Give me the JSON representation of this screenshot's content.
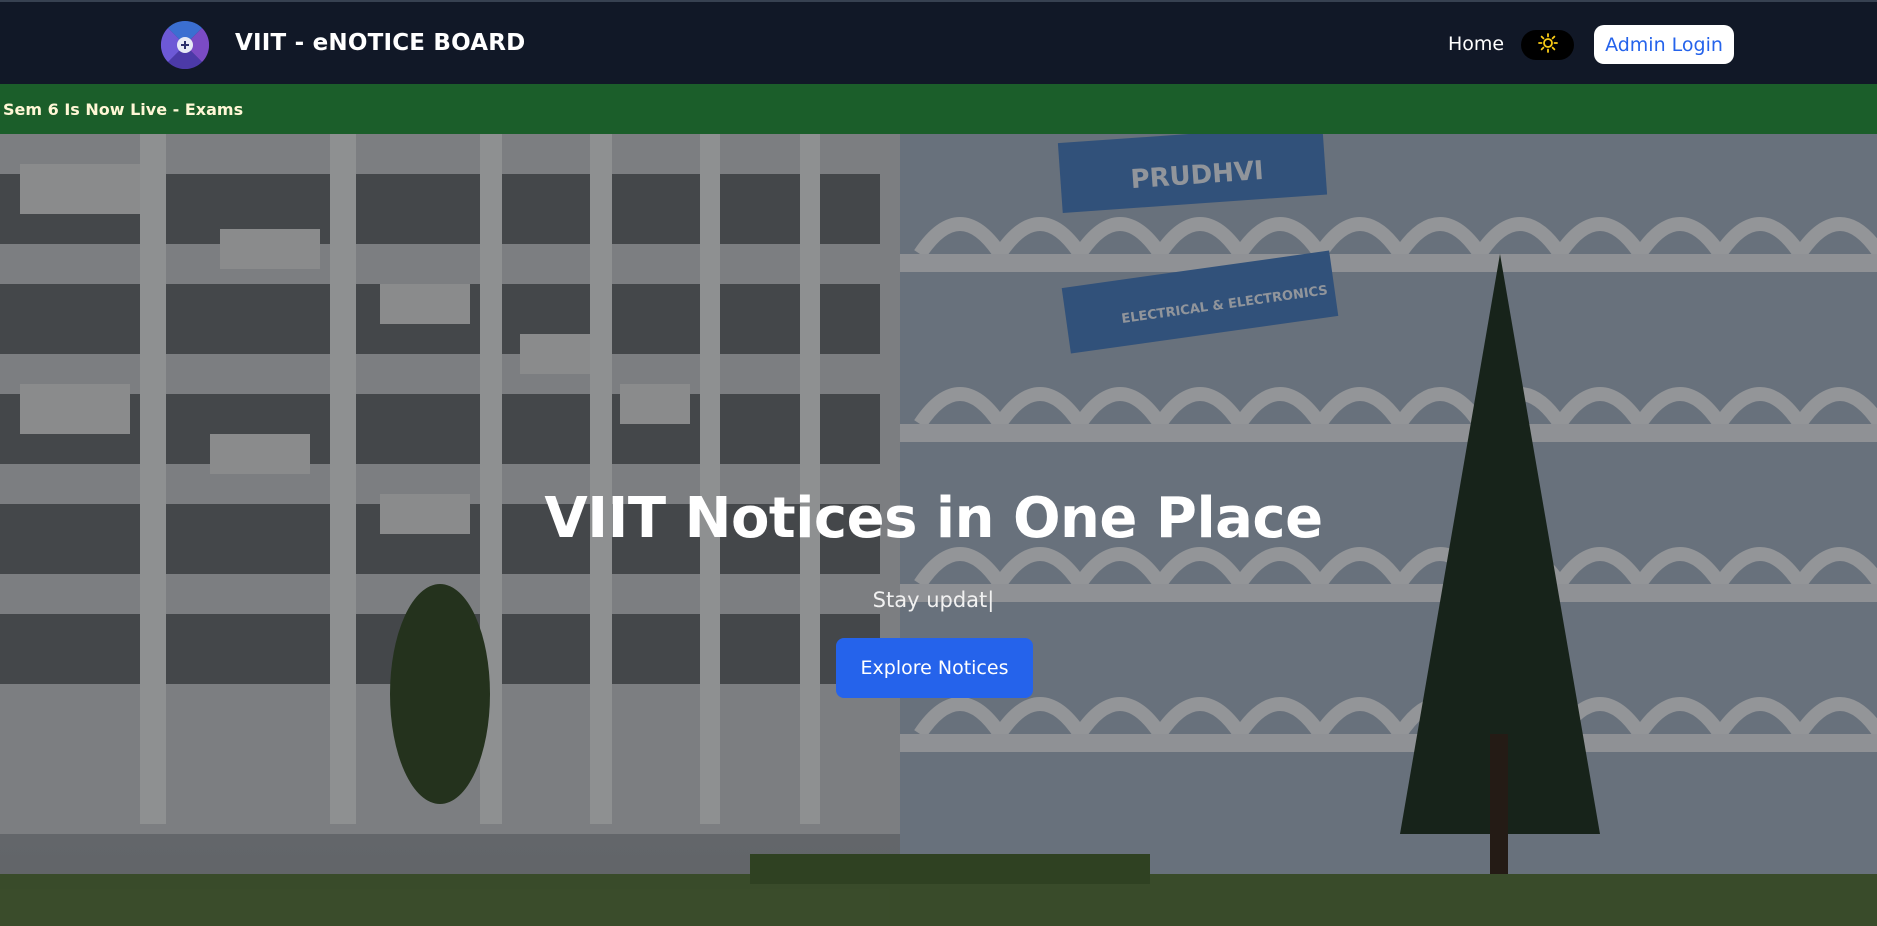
{
  "header": {
    "brand_title": "VIIT - eNOTICE BOARD",
    "logo_icon": "viit-logo-icon",
    "nav_home": "Home",
    "theme_toggle_icon": "sun-icon",
    "admin_login": "Admin Login"
  },
  "ticker": {
    "text": "Sem 6 Is Now Live - Exams"
  },
  "hero": {
    "title": "VIIT Notices in One Place",
    "subtitle": "Stay updat|",
    "cta": "Explore Notices",
    "building_signs": [
      "PRUDHVI",
      "ELECTRICAL & ELECTRONICS"
    ]
  },
  "colors": {
    "navbar": "#111827",
    "ticker": "#1b5e2a",
    "accent": "#2563eb"
  }
}
